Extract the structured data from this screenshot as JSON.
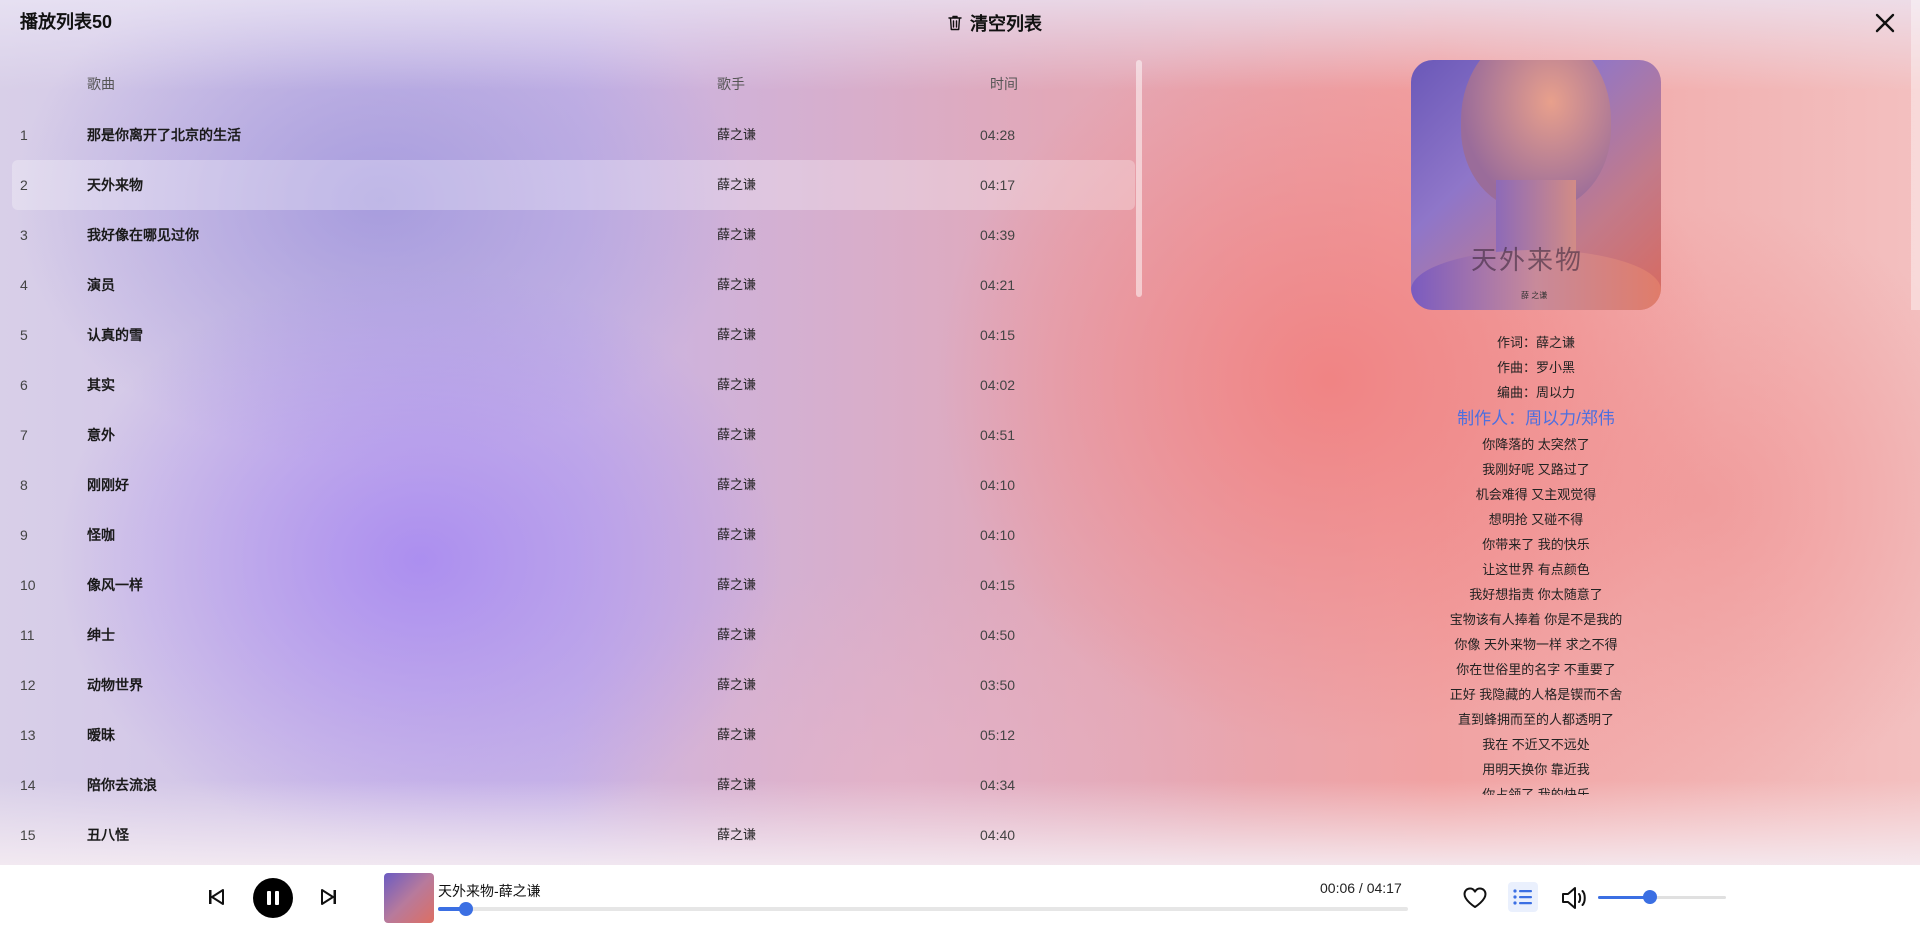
{
  "header": {
    "playlist_title": "播放列表50",
    "clear_label": "清空列表"
  },
  "columns": {
    "song": "歌曲",
    "artist": "歌手",
    "time": "时间"
  },
  "songs": [
    {
      "idx": "1",
      "name": "那是你离开了北京的生活",
      "artist": "薛之谦",
      "time": "04:28"
    },
    {
      "idx": "2",
      "name": "天外来物",
      "artist": "薛之谦",
      "time": "04:17"
    },
    {
      "idx": "3",
      "name": "我好像在哪见过你",
      "artist": "薛之谦",
      "time": "04:39"
    },
    {
      "idx": "4",
      "name": "演员",
      "artist": "薛之谦",
      "time": "04:21"
    },
    {
      "idx": "5",
      "name": "认真的雪",
      "artist": "薛之谦",
      "time": "04:15"
    },
    {
      "idx": "6",
      "name": "其实",
      "artist": "薛之谦",
      "time": "04:02"
    },
    {
      "idx": "7",
      "name": "意外",
      "artist": "薛之谦",
      "time": "04:51"
    },
    {
      "idx": "8",
      "name": "刚刚好",
      "artist": "薛之谦",
      "time": "04:10"
    },
    {
      "idx": "9",
      "name": "怪咖",
      "artist": "薛之谦",
      "time": "04:10"
    },
    {
      "idx": "10",
      "name": "像风一样",
      "artist": "薛之谦",
      "time": "04:15"
    },
    {
      "idx": "11",
      "name": "绅士",
      "artist": "薛之谦",
      "time": "04:50"
    },
    {
      "idx": "12",
      "name": "动物世界",
      "artist": "薛之谦",
      "time": "03:50"
    },
    {
      "idx": "13",
      "name": "暧昧",
      "artist": "薛之谦",
      "time": "05:12"
    },
    {
      "idx": "14",
      "name": "陪你去流浪",
      "artist": "薛之谦",
      "time": "04:34"
    },
    {
      "idx": "15",
      "name": "丑八怪",
      "artist": "薛之谦",
      "time": "04:40"
    }
  ],
  "active_song_index": 1,
  "album": {
    "art_text": "天外来物",
    "art_sub": "薛 之谦"
  },
  "lyrics": [
    "作词：薛之谦",
    "作曲：罗小黑",
    "编曲：周以力",
    "制作人：周以力/郑伟",
    "你降落的 太突然了",
    "我刚好呢 又路过了",
    "机会难得 又主观觉得",
    "想明抢 又碰不得",
    "你带来了 我的快乐",
    "让这世界 有点颜色",
    "我好想指责 你太随意了",
    "宝物该有人捧着 你是不是我的",
    "你像 天外来物一样 求之不得",
    "你在世俗里的名字 不重要了",
    "正好 我隐藏的人格是锲而不舍",
    "直到蜂拥而至的人都透明了",
    "我在 不近又不远处",
    "用明天换你 靠近我",
    "你占领了 我的快乐"
  ],
  "current_lyric_index": 3,
  "player": {
    "now_playing": "天外来物-薛之谦",
    "time_display": "00:06 / 04:17",
    "progress_fraction": 0.029,
    "volume_fraction": 0.41
  },
  "colors": {
    "accent": "#3b6fe3",
    "lyric_highlight": "#4c6fe0"
  }
}
